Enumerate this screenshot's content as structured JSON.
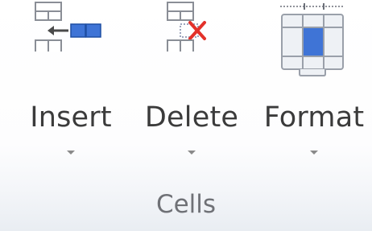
{
  "group": {
    "label": "Cells",
    "commands": [
      {
        "label": "Insert",
        "icon": "insert-cells-icon"
      },
      {
        "label": "Delete",
        "icon": "delete-cells-icon"
      },
      {
        "label": "Format",
        "icon": "format-cells-icon"
      }
    ]
  },
  "colors": {
    "label_text": "#3b3b3b",
    "group_label_text": "#6f7176",
    "accent_blue": "#3f74d6",
    "delete_red": "#e3312a"
  }
}
